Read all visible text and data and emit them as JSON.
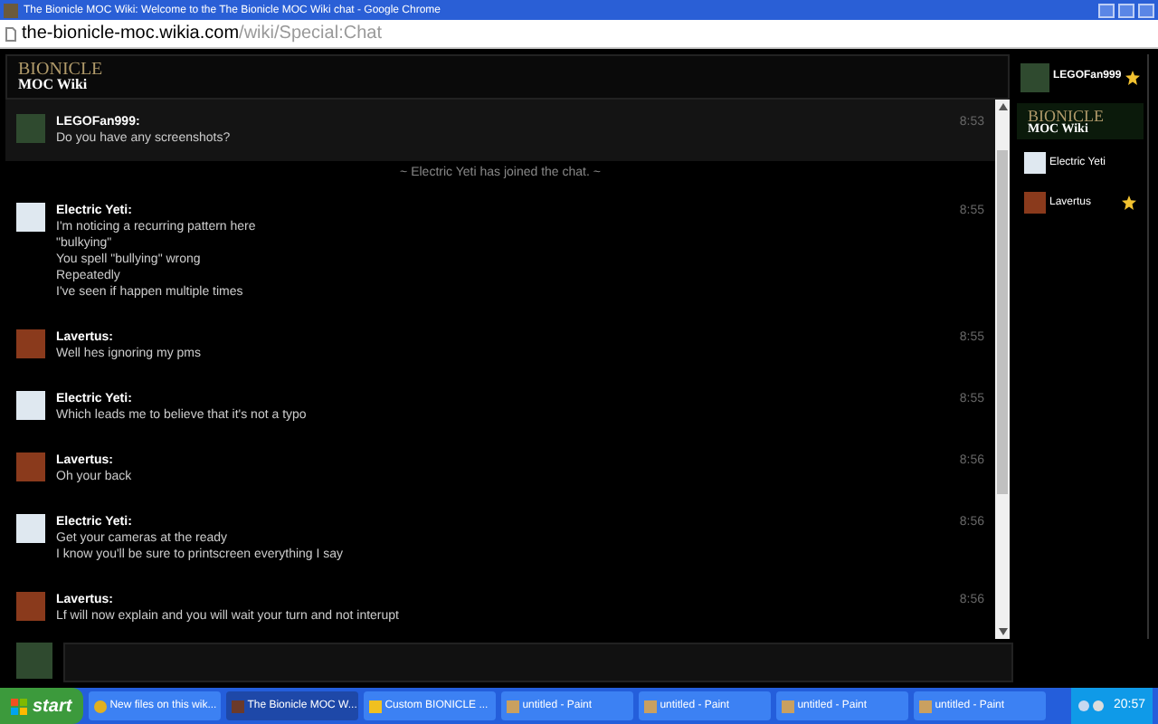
{
  "window": {
    "title": "The Bionicle MOC Wiki: Welcome to the The Bionicle MOC Wiki chat - Google Chrome"
  },
  "address_bar": {
    "host": "the-bionicle-moc.wikia.com",
    "path": "/wiki/Special:Chat"
  },
  "header": {
    "logo_top": "BIONICLE",
    "logo_bottom": "MOC Wiki"
  },
  "messages": [
    {
      "kind": "message",
      "user": "LEGOFan999:",
      "color": "#2f4a2f",
      "time": "8:53",
      "lines": [
        "Do you have any screenshots?"
      ],
      "selected": true
    },
    {
      "kind": "inline",
      "text": "~ Electric Yeti has joined the chat. ~"
    },
    {
      "kind": "message",
      "user": "Electric Yeti:",
      "color": "#dfe8f0",
      "time": "8:55",
      "lines": [
        "I'm noticing a recurring pattern here",
        "\"bulkying\"",
        "You spell \"bullying\" wrong",
        "Repeatedly",
        "I've seen if happen multiple times"
      ],
      "selected": false
    },
    {
      "kind": "message",
      "user": "Lavertus:",
      "color": "#8a3a1c",
      "time": "8:55",
      "lines": [
        "Well hes ignoring my pms"
      ],
      "selected": false
    },
    {
      "kind": "message",
      "user": "Electric Yeti:",
      "color": "#dfe8f0",
      "time": "8:55",
      "lines": [
        "Which leads me to believe that it's not a typo"
      ],
      "selected": false
    },
    {
      "kind": "message",
      "user": "Lavertus:",
      "color": "#8a3a1c",
      "time": "8:56",
      "lines": [
        "Oh your back"
      ],
      "selected": false
    },
    {
      "kind": "message",
      "user": "Electric Yeti:",
      "color": "#dfe8f0",
      "time": "8:56",
      "lines": [
        "Get your cameras at the ready",
        "I know you'll be sure to printscreen everything I say"
      ],
      "selected": false
    },
    {
      "kind": "message",
      "user": "Lavertus:",
      "color": "#8a3a1c",
      "time": "8:56",
      "lines": [
        "Lf will now explain and you will wait your turn and not interupt"
      ],
      "selected": false
    }
  ],
  "sidebar": {
    "me": {
      "name": "LEGOFan999",
      "color": "#2f4a2f",
      "star": true
    },
    "logo_top": "BIONICLE",
    "logo_bottom": "MOC Wiki",
    "users": [
      {
        "name": "Electric Yeti",
        "color": "#dfe8f0",
        "star": false
      },
      {
        "name": "Lavertus",
        "color": "#8a3a1c",
        "star": true
      }
    ]
  },
  "taskbar": {
    "start": "start",
    "items": [
      {
        "label": "New files on this wik...",
        "selected": false
      },
      {
        "label": "The Bionicle MOC W...",
        "selected": true
      },
      {
        "label": "Custom BIONICLE ...",
        "selected": false
      },
      {
        "label": "untitled - Paint",
        "selected": false
      },
      {
        "label": "untitled - Paint",
        "selected": false
      },
      {
        "label": "untitled - Paint",
        "selected": false
      },
      {
        "label": "untitled - Paint",
        "selected": false
      }
    ],
    "clock": "20:57"
  }
}
